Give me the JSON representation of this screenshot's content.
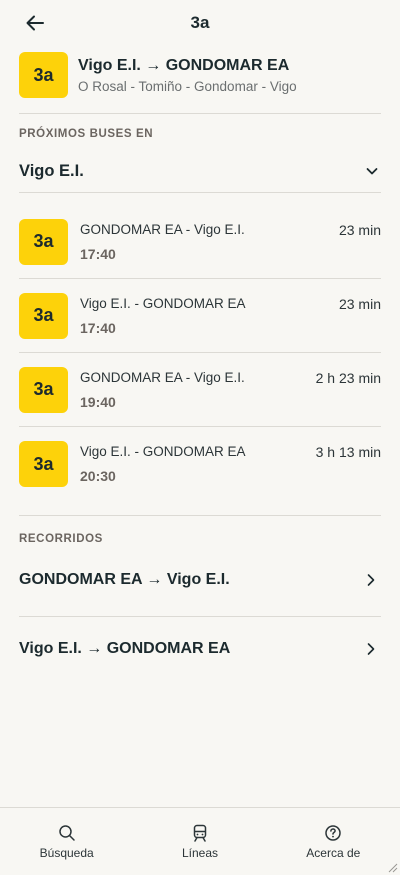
{
  "header": {
    "title": "3a",
    "back_icon": "arrow-left-icon"
  },
  "line": {
    "badge": "3a",
    "route": "Vigo E.I. → GONDOMAR EA",
    "subtitle": "O Rosal - Tomiño - Gondomar - Vigo",
    "badge_color": "#fdd20a"
  },
  "next_buses": {
    "section_label": "PRÓXIMOS BUSES EN",
    "selected_stop": "Vigo E.I.",
    "items": [
      {
        "badge": "3a",
        "destination": "GONDOMAR EA - Vigo E.I.",
        "time": "17:40",
        "eta": "23 min"
      },
      {
        "badge": "3a",
        "destination": "Vigo E.I. - GONDOMAR EA",
        "time": "17:40",
        "eta": "23 min"
      },
      {
        "badge": "3a",
        "destination": "GONDOMAR EA - Vigo E.I.",
        "time": "19:40",
        "eta": "2 h 23 min"
      },
      {
        "badge": "3a",
        "destination": "Vigo E.I. - GONDOMAR EA",
        "time": "20:30",
        "eta": "3 h 13 min"
      }
    ]
  },
  "routes": {
    "section_label": "RECORRIDOS",
    "items": [
      {
        "label": "GONDOMAR EA → Vigo E.I."
      },
      {
        "label": "Vigo E.I. → GONDOMAR EA"
      }
    ]
  },
  "tabbar": {
    "items": [
      {
        "label": "Búsqueda",
        "icon": "search-icon"
      },
      {
        "label": "Líneas",
        "icon": "train-icon"
      },
      {
        "label": "Acerca de",
        "icon": "help-circle-icon"
      }
    ]
  }
}
